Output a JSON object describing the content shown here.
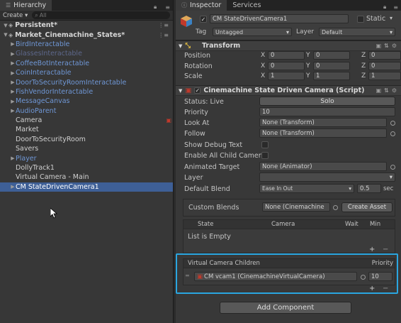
{
  "hierarchy": {
    "tab_label": "Hierarchy",
    "create_label": "Create",
    "search_placeholder": "All",
    "items": [
      {
        "label": "Persistent*",
        "kind": "scene"
      },
      {
        "label": "Market_Cinemachine_States*",
        "kind": "scene"
      },
      {
        "label": "BirdInteractable",
        "kind": "prefab"
      },
      {
        "label": "GlassesInteractable",
        "kind": "prefab-faded"
      },
      {
        "label": "CoffeeBotInteractable",
        "kind": "prefab"
      },
      {
        "label": "CoinInteractable",
        "kind": "prefab"
      },
      {
        "label": "DoorToSecurityRoomInteractable",
        "kind": "prefab"
      },
      {
        "label": "FishVendorInteractable",
        "kind": "prefab"
      },
      {
        "label": "MessageCanvas",
        "kind": "prefab"
      },
      {
        "label": "AudioParent",
        "kind": "prefab"
      },
      {
        "label": "Camera",
        "kind": "object"
      },
      {
        "label": "Market",
        "kind": "object"
      },
      {
        "label": "DoorToSecurityRoom",
        "kind": "object"
      },
      {
        "label": "Savers",
        "kind": "object"
      },
      {
        "label": "Player",
        "kind": "prefab"
      },
      {
        "label": "DollyTrack1",
        "kind": "object"
      },
      {
        "label": "Virtual Camera - Main",
        "kind": "object"
      },
      {
        "label": "CM StateDrivenCamera1",
        "kind": "selected"
      }
    ]
  },
  "inspector": {
    "tab_label": "Inspector",
    "services_label": "Services",
    "object_name": "CM StateDrivenCamera1",
    "static_label": "Static",
    "tag_label": "Tag",
    "tag_value": "Untagged",
    "layer_label": "Layer",
    "layer_value": "Default",
    "transform": {
      "title": "Transform",
      "rows": [
        {
          "label": "Position",
          "x": "0",
          "y": "0",
          "z": "0"
        },
        {
          "label": "Rotation",
          "x": "0",
          "y": "0",
          "z": "0"
        },
        {
          "label": "Scale",
          "x": "1",
          "y": "1",
          "z": "1"
        }
      ],
      "axis_x": "X",
      "axis_y": "Y",
      "axis_z": "Z"
    },
    "sdc": {
      "title": "Cinemachine State Driven Camera (Script)",
      "status_label": "Status: Live",
      "solo_label": "Solo",
      "priority_label": "Priority",
      "priority_value": "10",
      "look_at_label": "Look At",
      "look_at_value": "None (Transform)",
      "follow_label": "Follow",
      "follow_value": "None (Transform)",
      "show_debug_label": "Show Debug Text",
      "enable_children_label": "Enable All Child Camer",
      "animated_target_label": "Animated Target",
      "animated_target_value": "None (Animator)",
      "layer_label": "Layer",
      "default_blend_label": "Default Blend",
      "default_blend_value": "Ease In Out",
      "blend_time": "0.5",
      "blend_unit": "sec",
      "custom_blends_label": "Custom Blends",
      "custom_blends_value": "None (Cinemachine",
      "create_asset_label": "Create Asset",
      "states_header": {
        "state": "State",
        "camera": "Camera",
        "wait": "Wait",
        "min": "Min"
      },
      "list_empty": "List is Empty",
      "children_header": "Virtual Camera Children",
      "children_priority_header": "Priority",
      "child_name": "CM vcam1 (CinemachineVirtualCamera)",
      "child_priority": "10"
    },
    "add_component_label": "Add Component"
  }
}
